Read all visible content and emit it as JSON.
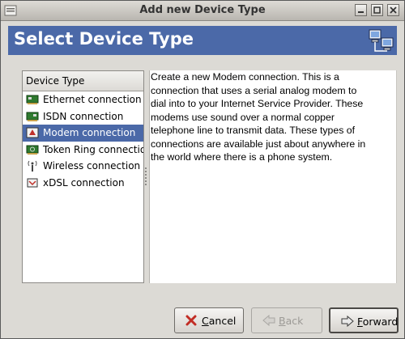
{
  "window": {
    "title": "Add new Device Type"
  },
  "header": {
    "title": "Select Device Type",
    "icon": "network-computers-icon"
  },
  "device_list": {
    "column_header": "Device Type",
    "items": [
      {
        "label": "Ethernet connection",
        "icon": "network-card-icon",
        "selected": false
      },
      {
        "label": "ISDN connection",
        "icon": "isdn-card-icon",
        "selected": false
      },
      {
        "label": "Modem connection",
        "icon": "modem-icon",
        "selected": true
      },
      {
        "label": "Token Ring connection",
        "icon": "token-ring-card-icon",
        "selected": false
      },
      {
        "label": "Wireless connection",
        "icon": "wireless-icon",
        "selected": false
      },
      {
        "label": "xDSL connection",
        "icon": "xdsl-icon",
        "selected": false
      }
    ]
  },
  "description": {
    "lines": [
      "Create a new Modem connection.  This is a",
      "connection that uses a serial analog modem to",
      "dial into to your Internet Service Provider. These",
      "modems use sound over a normal copper",
      "telephone line to transmit data.  These types of",
      "connections are available just about anywhere in",
      "the world where there is a phone system."
    ]
  },
  "buttons": {
    "cancel": {
      "mnemonic": "C",
      "rest": "ancel",
      "enabled": true
    },
    "back": {
      "mnemonic": "B",
      "rest": "ack",
      "enabled": false
    },
    "forward": {
      "mnemonic": "F",
      "rest": "orward",
      "enabled": true
    }
  },
  "colors": {
    "header_bg": "#4b69a8",
    "selection_bg": "#4b69a8",
    "dialog_bg": "#dcdad5"
  }
}
